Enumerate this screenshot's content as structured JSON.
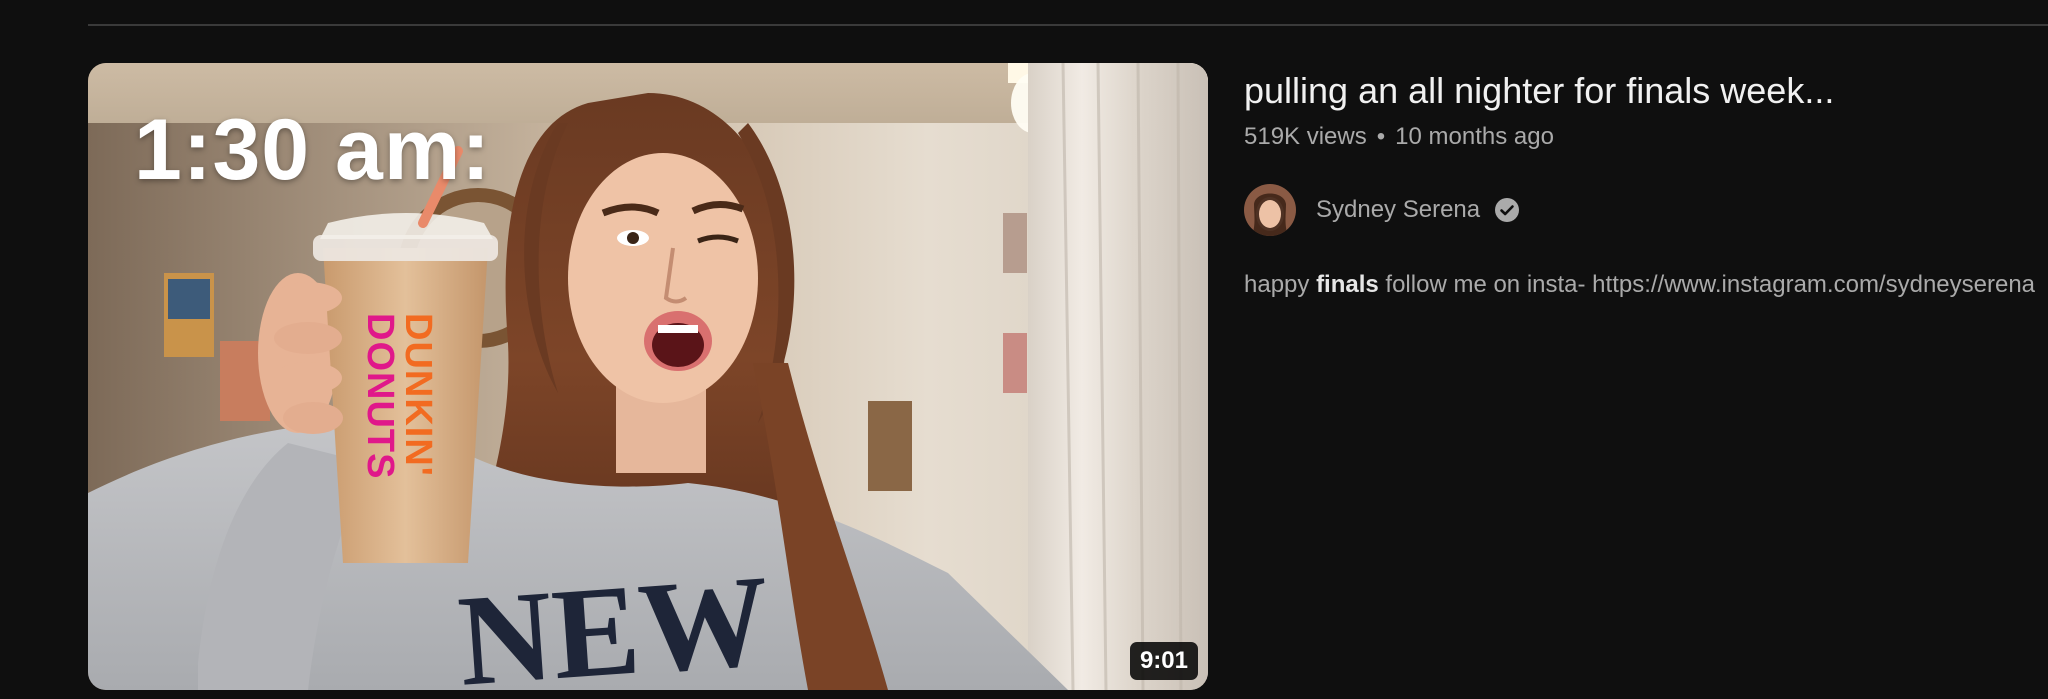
{
  "result": {
    "thumbnail": {
      "caption": "1:30 am:",
      "cup_text": "DUNKIN' DONUTS",
      "sweatshirt_text": "NEW",
      "duration": "9:01"
    },
    "title": "pulling an all nighter for finals week...",
    "views": "519K views",
    "separator": "•",
    "age": "10 months ago",
    "channel": {
      "name": "Sydney Serena",
      "verified_icon": "verified-check-icon"
    },
    "description": {
      "before": "happy ",
      "highlight": "finals",
      "after": " follow me on insta- https://www.instagram.com/sydneyserena"
    }
  },
  "colors": {
    "background": "#0f0f0f",
    "title": "#f1f1f1",
    "secondary_text": "#aaaaaa",
    "divider": "#3a3a3a",
    "dunkin_orange": "#f26b21",
    "dunkin_pink": "#e0188a"
  }
}
